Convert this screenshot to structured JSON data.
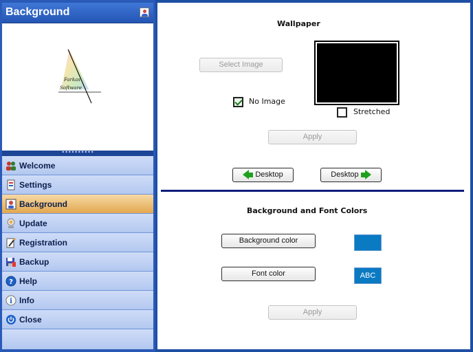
{
  "sidebar": {
    "title": "Background",
    "logo": {
      "line1": "Farkas",
      "line2": "Software"
    },
    "splitter": "••••••••••",
    "items": [
      {
        "label": "Welcome",
        "icon": "users-icon",
        "active": false
      },
      {
        "label": "Settings",
        "icon": "settings-icon",
        "active": false
      },
      {
        "label": "Background",
        "icon": "background-icon",
        "active": true
      },
      {
        "label": "Update",
        "icon": "update-icon",
        "active": false
      },
      {
        "label": "Registration",
        "icon": "registration-icon",
        "active": false
      },
      {
        "label": "Backup",
        "icon": "backup-icon",
        "active": false
      },
      {
        "label": "Help",
        "icon": "help-icon",
        "active": false
      },
      {
        "label": "Info",
        "icon": "info-icon",
        "active": false
      },
      {
        "label": "Close",
        "icon": "power-icon",
        "active": false
      }
    ]
  },
  "wallpaper": {
    "title": "Wallpaper",
    "select_image_label": "Select Image",
    "no_image_label": "No Image",
    "no_image_checked": true,
    "stretched_label": "Stretched",
    "stretched_checked": false,
    "apply_label": "Apply",
    "desktop_prev_label": "Desktop",
    "desktop_next_label": "Desktop",
    "preview_color": "#000000"
  },
  "colors": {
    "title": "Background and Font Colors",
    "background_color_label": "Background color",
    "font_color_label": "Font color",
    "background_swatch": "#0a7ac2",
    "font_swatch_sample": "ABC",
    "apply_label": "Apply"
  },
  "theme": {
    "frame": "#1e4fa3",
    "active_item": "#e3a850",
    "divider": "#0c1c7c"
  }
}
